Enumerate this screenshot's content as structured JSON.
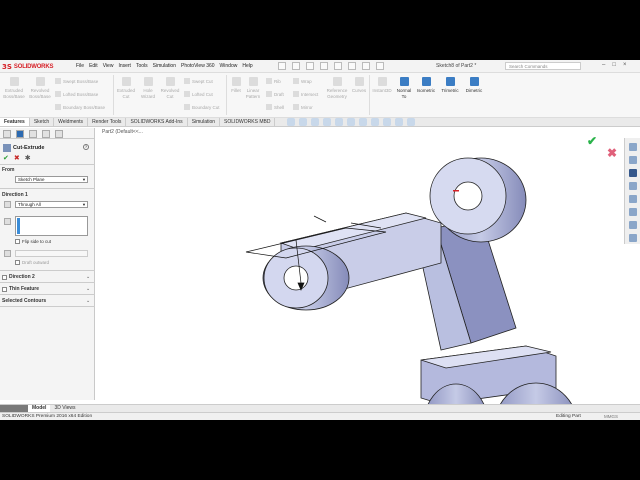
{
  "app": {
    "logo_ds": "3S",
    "logo_text": "SOLIDWORKS",
    "document_title": "Sketch8 of Part2 *"
  },
  "menu": [
    "File",
    "Edit",
    "View",
    "Insert",
    "Tools",
    "Simulation",
    "PhotoView 360",
    "Window",
    "Help"
  ],
  "search": {
    "placeholder": "Search Commands"
  },
  "window_controls": {
    "minimize": "–",
    "maximize": "□",
    "close": "×"
  },
  "commands": {
    "extruded_boss": "Extruded Boss/Base",
    "revolved_boss": "Revolved Boss/Base",
    "swept_boss": "Swept Boss/Base",
    "lofted_boss": "Lofted Boss/Base",
    "boundary_boss": "Boundary Boss/Base",
    "extruded_cut": "Extruded Cut",
    "hole_wizard": "Hole Wizard",
    "revolved_cut": "Revolved Cut",
    "swept_cut": "Swept Cut",
    "lofted_cut": "Lofted Cut",
    "boundary_cut": "Boundary Cut",
    "fillet": "Fillet",
    "linear_pattern": "Linear Pattern",
    "rib": "Rib",
    "draft": "Draft",
    "shell": "Shell",
    "wrap": "Wrap",
    "intersect": "Intersect",
    "mirror": "Mirror",
    "reference_geometry": "Reference Geometry",
    "curves": "Curves",
    "instant3d": "Instant3D",
    "normal_to": "Normal To",
    "isometric": "Isometric",
    "trimetric": "Trimetric",
    "dimetric": "Dimetric"
  },
  "tabs": [
    "Features",
    "Sketch",
    "Weldments",
    "Render Tools",
    "SOLIDWORKS Add-Ins",
    "Simulation",
    "SOLIDWORKS MBD"
  ],
  "active_tab": "Features",
  "breadcrumb": "Part2 (Default<<...",
  "property_manager": {
    "title": "Cut-Extrude",
    "help": "?",
    "ok": "✔",
    "cancel": "✖",
    "pin": "✱",
    "from": {
      "label": "From",
      "value": "Sketch Plane"
    },
    "direction1": {
      "label": "Direction 1",
      "end_condition": "Through All",
      "flip_side": "Flip side to cut",
      "draft_outward": "Draft outward"
    },
    "direction2": "Direction 2",
    "thin_feature": "Thin Feature",
    "selected_contours": "Selected Contours"
  },
  "bottom_tabs": [
    "Model",
    "3D Views"
  ],
  "status": {
    "left": "SOLIDWORKS Premium 2016 x64 Edition",
    "middle": "Editing Part",
    "right": "MMGS"
  }
}
